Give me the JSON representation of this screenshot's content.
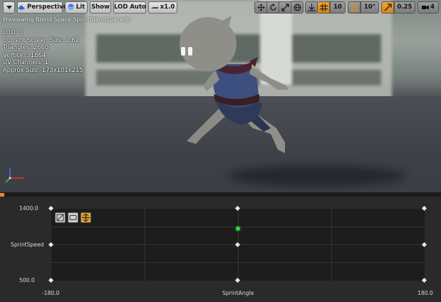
{
  "toolbar": {
    "menu_icon": "dropdown-arrow-icon",
    "perspective_label": "Perspective",
    "lit_label": "Lit",
    "show_label": "Show",
    "lod_label": "LOD Auto",
    "play_rate_label": "x1.0",
    "grid_snap_value": "10",
    "rotation_snap_value": "10°",
    "scale_snap_value": "0.25",
    "camera_speed_value": "4",
    "accent_color": "#e58d1e"
  },
  "viewport": {
    "preview_text": "Previewing Blend Space SprintBlendSpace2d",
    "stats": [
      "LOD: 0",
      "Current Screen Size: 1.62",
      "Triangles: 2660",
      "Vertices: 1864",
      "UV Channels: 1",
      "Approx Size: 173x101x215"
    ]
  },
  "blend_space": {
    "y_axis": {
      "name": "SprintSpeed",
      "max_label": "1400.0",
      "min_label": "500.0"
    },
    "x_axis": {
      "name": "SprintAngle",
      "min_label": "-180.0",
      "max_label": "180.0"
    },
    "tools": [
      "grid-snap-icon",
      "show-triangulation-icon",
      "preview-lock-icon"
    ],
    "preview_point": {
      "x": 0.0,
      "y": 1150.0
    },
    "samples": [
      {
        "x": -180,
        "y": 1400
      },
      {
        "x": 0,
        "y": 1400
      },
      {
        "x": 180,
        "y": 1400
      },
      {
        "x": -180,
        "y": 950
      },
      {
        "x": 0,
        "y": 950
      },
      {
        "x": 180,
        "y": 950
      },
      {
        "x": -180,
        "y": 500
      },
      {
        "x": 0,
        "y": 500
      },
      {
        "x": 180,
        "y": 500
      }
    ],
    "x_range": [
      -180,
      180
    ],
    "y_range": [
      500,
      1400
    ]
  }
}
